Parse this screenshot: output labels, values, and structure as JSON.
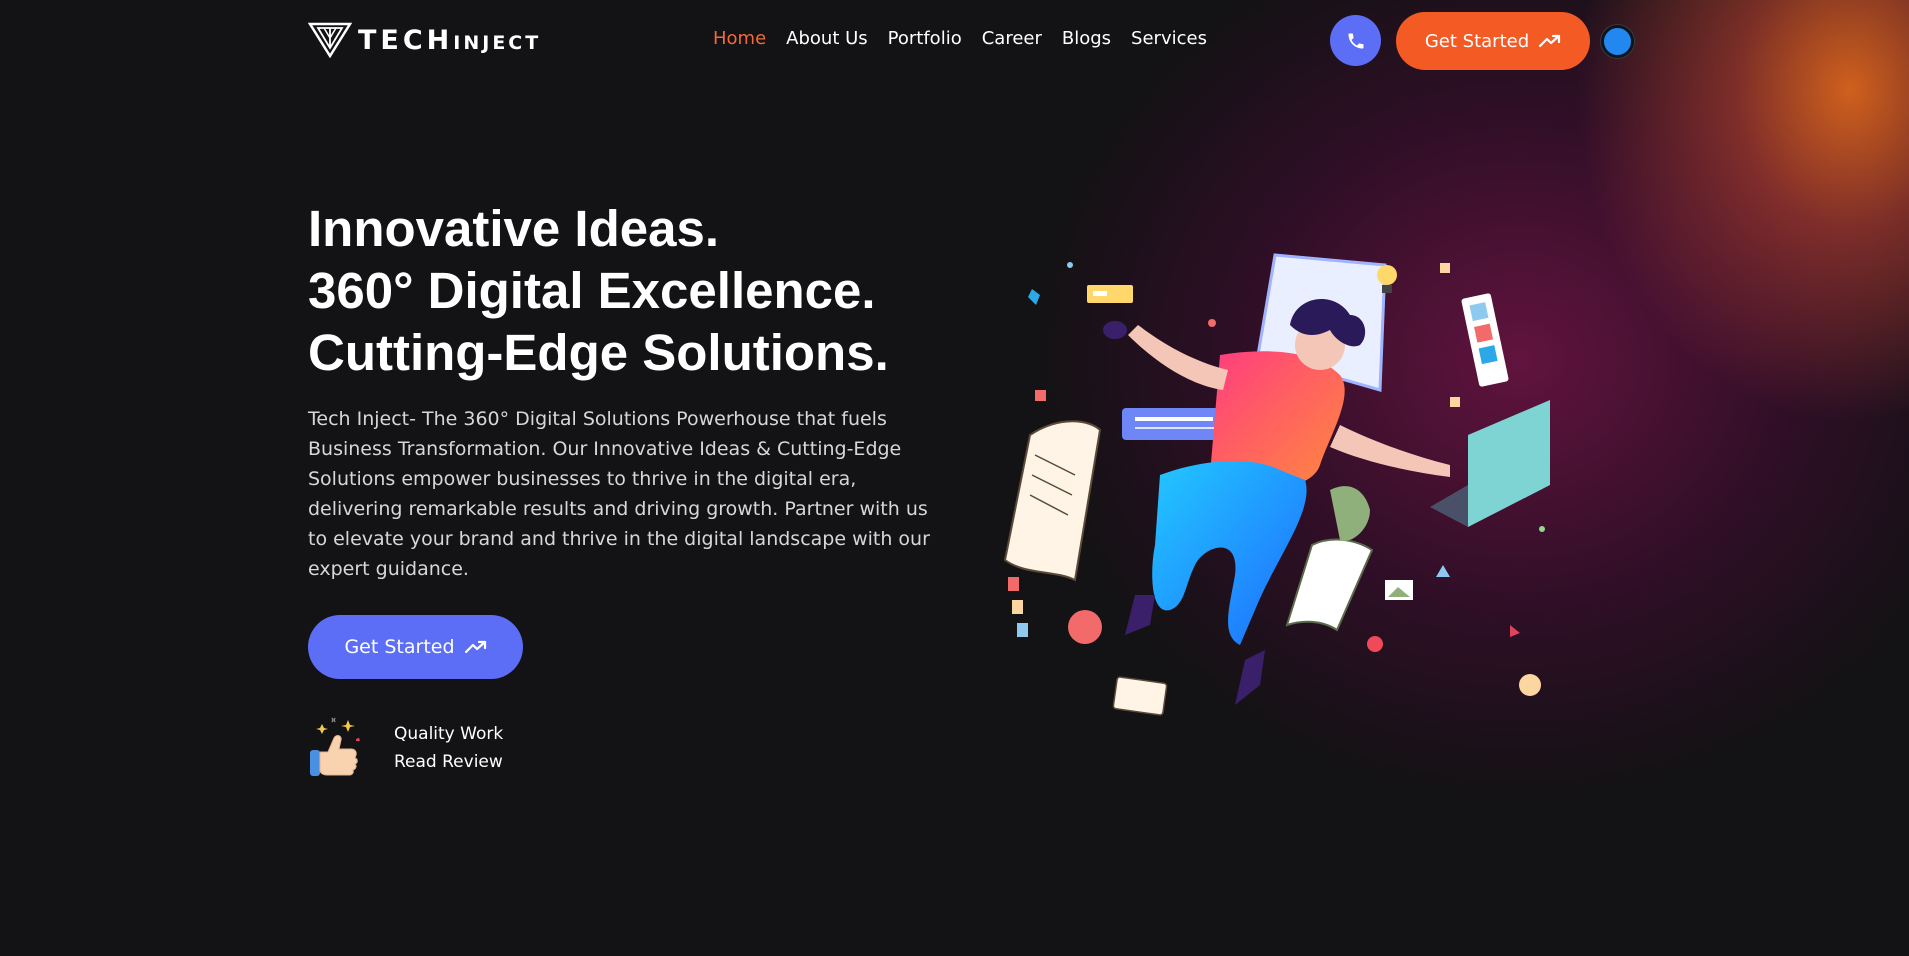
{
  "brand": {
    "name_primary": "TECH",
    "name_secondary": "INJECT"
  },
  "nav": {
    "items": [
      {
        "label": "Home",
        "active": true
      },
      {
        "label": "About Us",
        "active": false
      },
      {
        "label": "Portfolio",
        "active": false
      },
      {
        "label": "Career",
        "active": false
      },
      {
        "label": "Blogs",
        "active": false
      },
      {
        "label": "Services",
        "active": false
      }
    ],
    "cta_label": "Get Started",
    "phone_icon": "phone-icon",
    "theme_icon": "theme-toggle-icon"
  },
  "hero": {
    "title_lines": [
      "Innovative Ideas.",
      "360° Digital Excellence.",
      "Cutting-Edge Solutions."
    ],
    "description": "Tech Inject- The 360° Digital Solutions Powerhouse that fuels Business Transformation. Our Innovative Ideas & Cutting-Edge Solutions empower businesses to thrive in the digital era, delivering remarkable results and driving growth. Partner with us to elevate your brand and thrive in the digital landscape with our expert guidance.",
    "cta_label": "Get Started",
    "review": {
      "line1": "Quality Work",
      "line2": "Read Review",
      "icon": "thumbs-up-icon"
    }
  },
  "colors": {
    "background": "#131214",
    "accent_orange": "#f45a23",
    "accent_blue": "#5b6ef5",
    "active_link": "#f26a3b"
  }
}
